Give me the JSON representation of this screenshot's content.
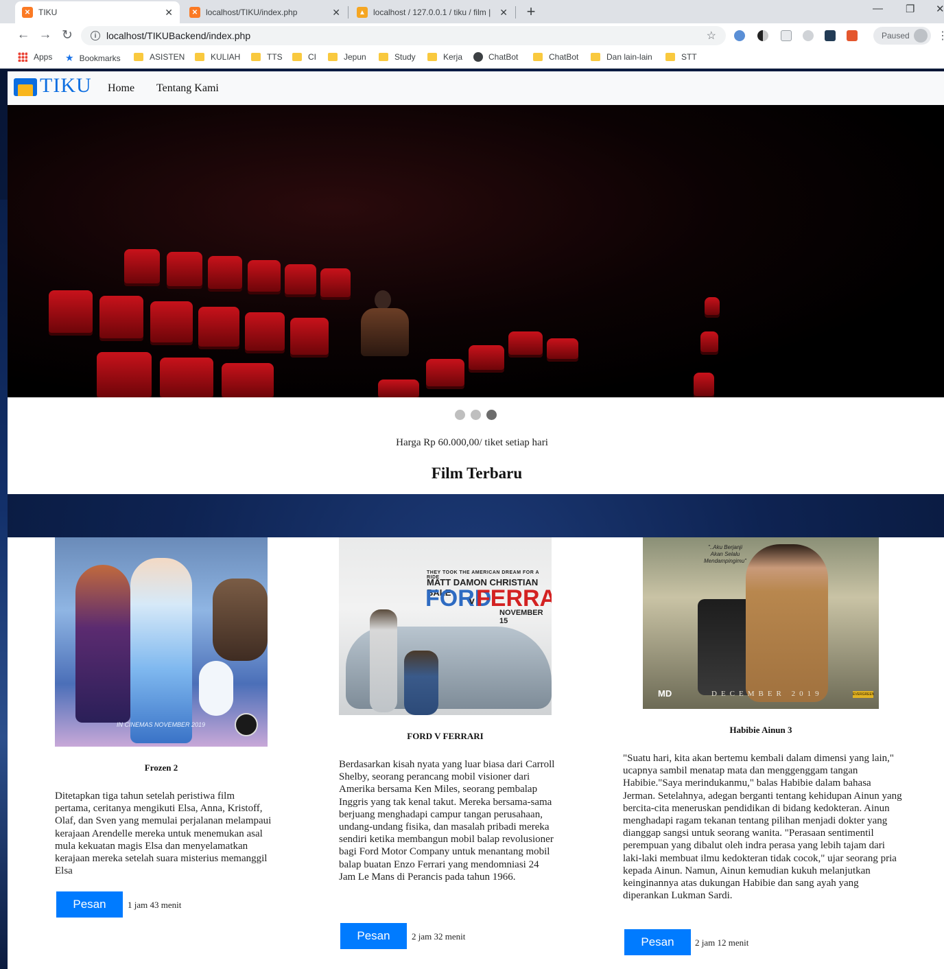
{
  "browser": {
    "tabs": [
      {
        "title": "TIKU",
        "favicon": "xampp-icon"
      },
      {
        "title": "localhost/TIKU/index.php",
        "favicon": "xampp-icon"
      },
      {
        "title": "localhost / 127.0.0.1 / tiku / film |",
        "favicon": "phpmyadmin-icon"
      }
    ],
    "url": "localhost/TIKUBackend/index.php",
    "profile_status": "Paused",
    "bookmarks": [
      "Apps",
      "Bookmarks",
      "ASISTEN",
      "KULIAH",
      "TTS",
      "CI",
      "Jepun",
      "Study",
      "Kerja",
      "ChatBot",
      "ChatBot",
      "Dan lain-lain",
      "STT"
    ]
  },
  "site": {
    "brand": "TIKU",
    "nav": [
      "Home",
      "Tentang Kami"
    ],
    "carousel_count": 3,
    "carousel_active": 3,
    "price_text": "Harga Rp 60.000,00/ tiket setiap hari",
    "section_title": "Film Terbaru"
  },
  "films": [
    {
      "title": "Frozen 2",
      "poster_caption": "IN CINEMAS NOVEMBER 2019",
      "description": "Ditetapkan tiga tahun setelah peristiwa film pertama, ceritanya mengikuti Elsa, Anna, Kristoff, Olaf, dan Sven yang memulai perjalanan melampaui kerajaan Arendelle mereka untuk menemukan asal mula kekuatan magis Elsa dan menyelamatkan kerajaan mereka setelah suara misterius memanggil Elsa",
      "button": "Pesan",
      "duration": "1 jam 43 menit"
    },
    {
      "title": "FORD V FERRARI",
      "poster_tagline": "THEY TOOK THE AMERICAN DREAM FOR A RIDE",
      "poster_names": "MATT DAMON  CHRISTIAN BALE",
      "poster_ford": "FORD",
      "poster_v": "v",
      "poster_ferrari": "FERRARI",
      "poster_date": "NOVEMBER 15",
      "description": "Berdasarkan kisah nyata yang luar biasa dari Carroll Shelby, seorang perancang mobil visioner dari Amerika bersama Ken Miles, seorang pembalap Inggris yang tak kenal takut. Mereka bersama-sama berjuang menghadapi campur tangan perusahaan, undang-undang fisika, dan masalah pribadi mereka sendiri ketika membangun mobil balap revolusioner bagi Ford Motor Company untuk menantang mobil balap buatan Enzo Ferrari yang mendomniasi 24 Jam Le Mans di Perancis pada tahun 1966.",
      "button": "Pesan",
      "duration": "2 jam 32 menit"
    },
    {
      "title": "Habibie Ainun 3",
      "poster_quote": "\"..Aku Berjanji Akan Selalu Mendampingimu\"",
      "poster_date": "DECEMBER 2019",
      "poster_studio": "MD",
      "poster_distributor": "EVERGREEN",
      "description": "\"Suatu hari, kita akan bertemu kembali dalam dimensi yang lain,\" ucapnya sambil menatap mata dan menggenggam tangan Habibie.\"Saya merindukanmu,\" balas Habibie dalam bahasa Jerman. Setelahnya, adegan berganti tentang kehidupan Ainun yang bercita-cita meneruskan pendidikan di bidang kedokteran. Ainun menghadapi ragam tekanan tentang pilihan menjadi dokter yang dianggap sangsi untuk seorang wanita. \"Perasaan sentimentil perempuan yang dibalut oleh indra perasa yang lebih tajam dari laki-laki membuat ilmu kedokteran tidak cocok,\" ujar seorang pria kepada Ainun. Namun, Ainun kemudian kukuh melanjutkan keinginannya atas dukungan Habibie dan sang ayah yang diperankan Lukman Sardi.",
      "button": "Pesan",
      "duration": "2 jam 12 menit"
    }
  ],
  "colors": {
    "brand_blue": "#0b6de0",
    "button_blue": "#007bff",
    "seat_red": "#c8121b"
  }
}
